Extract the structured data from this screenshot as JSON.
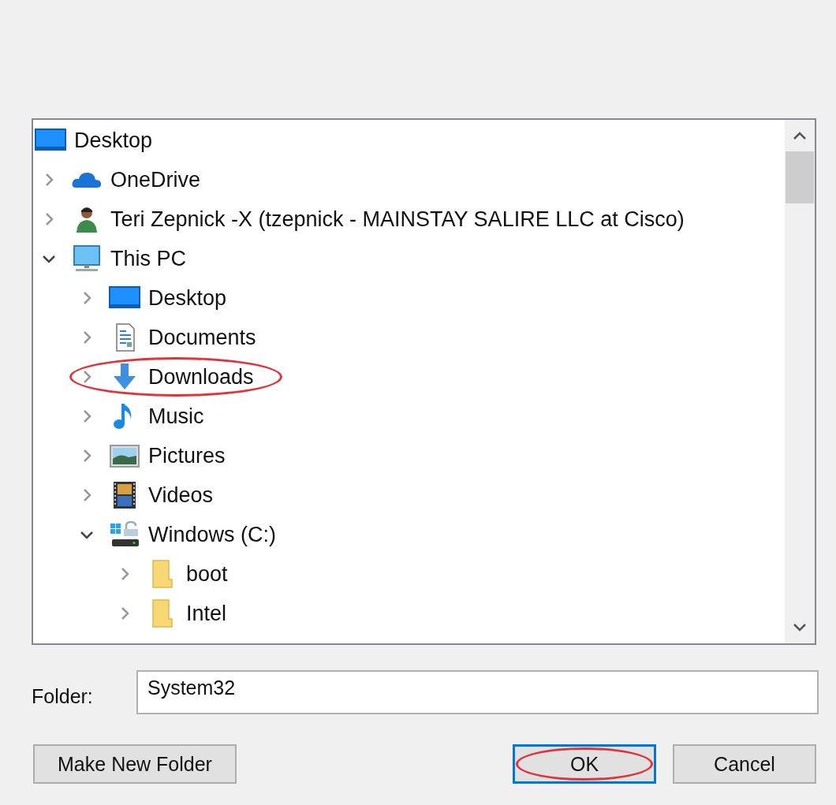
{
  "tree": [
    {
      "label": "Desktop",
      "kind": "desktop",
      "circled": false,
      "children": [
        {
          "label": "OneDrive",
          "kind": "cloud",
          "expanded": false,
          "circled": false
        },
        {
          "label": "Teri Zepnick -X (tzepnick - MAINSTAY SALIRE LLC at Cisco)",
          "kind": "user",
          "expanded": false,
          "circled": false
        },
        {
          "label": "This PC",
          "kind": "pc",
          "expanded": true,
          "circled": false,
          "children": [
            {
              "label": "Desktop",
              "kind": "desktop",
              "expanded": false,
              "circled": false
            },
            {
              "label": "Documents",
              "kind": "documents",
              "expanded": false,
              "circled": false
            },
            {
              "label": "Downloads",
              "kind": "downloads",
              "expanded": false,
              "circled": true
            },
            {
              "label": "Music",
              "kind": "music",
              "expanded": false,
              "circled": false
            },
            {
              "label": "Pictures",
              "kind": "pictures",
              "expanded": false,
              "circled": false
            },
            {
              "label": "Videos",
              "kind": "videos",
              "expanded": false,
              "circled": false
            },
            {
              "label": "Windows (C:)",
              "kind": "drive",
              "expanded": true,
              "circled": false,
              "children": [
                {
                  "label": "boot",
                  "kind": "folder",
                  "expanded": false,
                  "circled": false
                },
                {
                  "label": "Intel",
                  "kind": "folder",
                  "expanded": false,
                  "circled": false
                }
              ]
            }
          ]
        }
      ]
    }
  ],
  "folder": {
    "label": "Folder:",
    "value": "System32"
  },
  "buttons": [
    {
      "label": "Make New Folder",
      "default": false,
      "circled": false
    },
    {
      "label": "OK",
      "default": true,
      "circled": true
    },
    {
      "label": "Cancel",
      "default": false,
      "circled": false
    }
  ]
}
